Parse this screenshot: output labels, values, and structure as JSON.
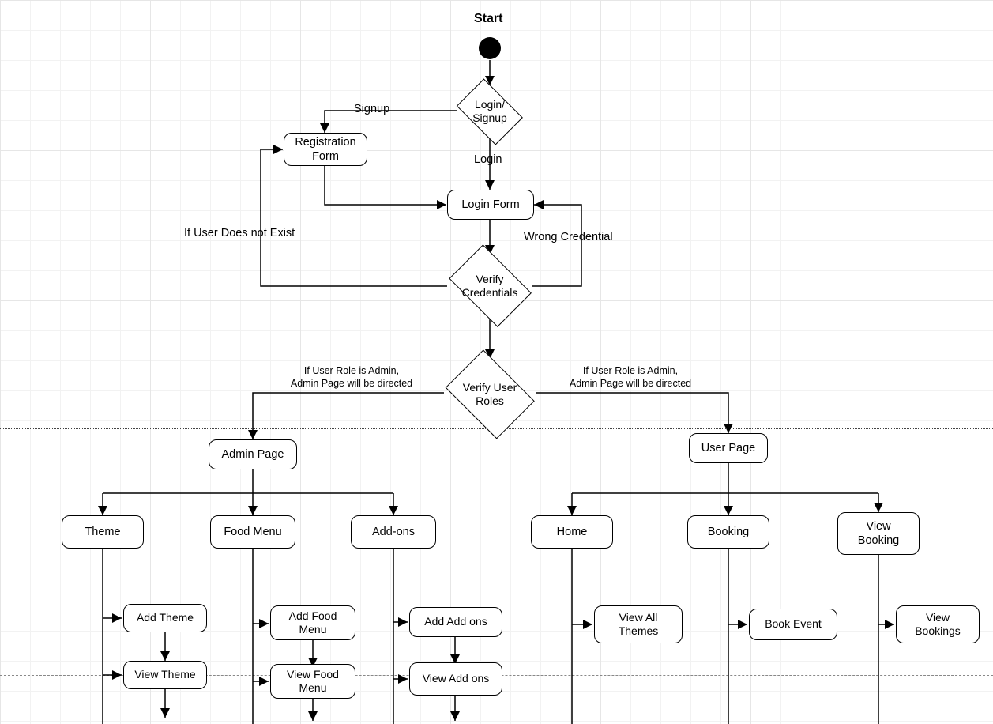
{
  "flowchart": {
    "type": "activity-diagram",
    "start": "Start",
    "decisions": {
      "login_signup": "Login/\nSignup",
      "verify_credentials": "Verify Credentials",
      "verify_roles": "Verify User Roles"
    },
    "nodes": {
      "registration_form": "Registration Form",
      "login_form": "Login Form",
      "admin_page": "Admin Page",
      "user_page": "User Page",
      "theme": "Theme",
      "food_menu": "Food Menu",
      "addons": "Add-ons",
      "home": "Home",
      "booking": "Booking",
      "view_booking": "View Booking",
      "add_theme": "Add Theme",
      "view_theme": "View Theme",
      "add_food_menu": "Add Food Menu",
      "view_food_menu": "View Food Menu",
      "add_addons": "Add Add ons",
      "view_addons": "View Add ons",
      "view_all_themes": "View All Themes",
      "book_event": "Book Event",
      "view_bookings": "View Bookings"
    },
    "edges": {
      "signup": "Signup",
      "login": "Login",
      "wrong_credential": "Wrong Credential",
      "user_not_exist": "If User Does not Exist",
      "role_admin_l": "If User Role is Admin,\nAdmin Page will be directed",
      "role_admin_r": "If User Role is Admin,\nAdmin Page will be directed"
    }
  }
}
